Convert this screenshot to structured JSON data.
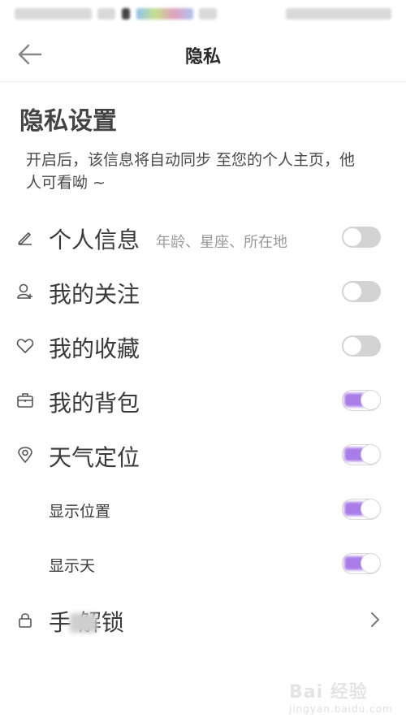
{
  "header": {
    "title": "隐私",
    "back_icon": "arrow-left-icon"
  },
  "section": {
    "title": "隐私设置",
    "description": "开启后，该信息将自动同步 至您的个人主页，他人可看呦 ~"
  },
  "rows": [
    {
      "label": "个人信息",
      "hint": "年龄、星座、所在地",
      "icon": "pencil-icon",
      "toggle": "off"
    },
    {
      "label": "我的关注",
      "icon": "user-add-icon",
      "toggle": "off"
    },
    {
      "label": "我的收藏",
      "icon": "heart-icon",
      "toggle": "off"
    },
    {
      "label": "我的背包",
      "icon": "briefcase-icon",
      "toggle": "on"
    },
    {
      "label": "天气定位",
      "icon": "location-icon",
      "toggle": "on"
    },
    {
      "label": "显示位置",
      "toggle": "on"
    },
    {
      "label": "显示天",
      "toggle": "on"
    },
    {
      "label": "手  解锁",
      "icon": "lock-icon",
      "action": "chevron-right-icon"
    }
  ],
  "colors": {
    "accent": "#a97ce8",
    "toggle_off": "#d3d3d3"
  },
  "watermark": {
    "text": "Bai 经验",
    "sub": "jingyan.baidu.com"
  }
}
